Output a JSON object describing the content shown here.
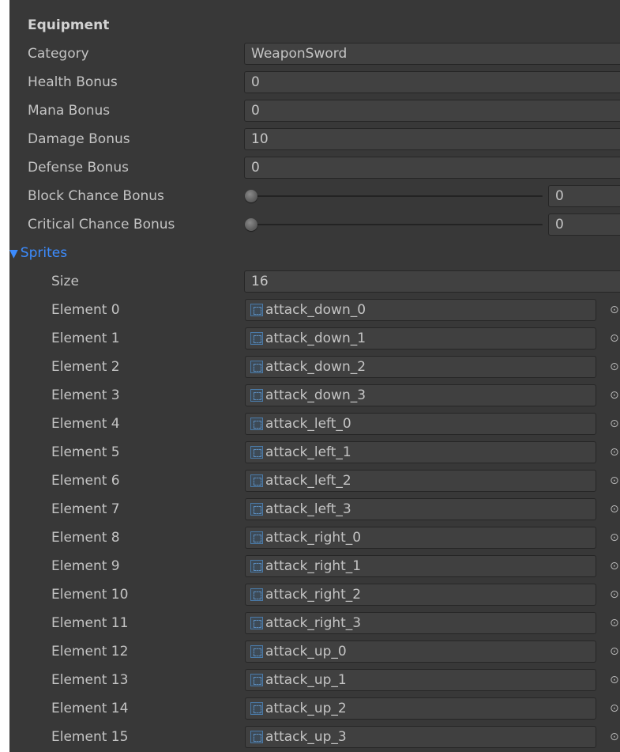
{
  "section_header": "Equipment",
  "fields": {
    "category": {
      "label": "Category",
      "value": "WeaponSword"
    },
    "health_bonus": {
      "label": "Health Bonus",
      "value": "0"
    },
    "mana_bonus": {
      "label": "Mana Bonus",
      "value": "0"
    },
    "damage_bonus": {
      "label": "Damage Bonus",
      "value": "10"
    },
    "defense_bonus": {
      "label": "Defense Bonus",
      "value": "0"
    },
    "block_chance_bonus": {
      "label": "Block Chance Bonus",
      "value": "0",
      "slider_fraction": 0
    },
    "critical_chance_bonus": {
      "label": "Critical Chance Bonus",
      "value": "0",
      "slider_fraction": 0
    }
  },
  "sprites": {
    "label": "Sprites",
    "foldout_icon": "triangle-down-icon",
    "expanded": true,
    "size_label": "Size",
    "size_value": "16",
    "picker_icon": "object-picker-icon",
    "item_icon": "sprite-asset-icon",
    "elements": [
      {
        "label": "Element 0",
        "value": "attack_down_0"
      },
      {
        "label": "Element 1",
        "value": "attack_down_1"
      },
      {
        "label": "Element 2",
        "value": "attack_down_2"
      },
      {
        "label": "Element 3",
        "value": "attack_down_3"
      },
      {
        "label": "Element 4",
        "value": "attack_left_0"
      },
      {
        "label": "Element 5",
        "value": "attack_left_1"
      },
      {
        "label": "Element 6",
        "value": "attack_left_2"
      },
      {
        "label": "Element 7",
        "value": "attack_left_3"
      },
      {
        "label": "Element 8",
        "value": "attack_right_0"
      },
      {
        "label": "Element 9",
        "value": "attack_right_1"
      },
      {
        "label": "Element 10",
        "value": "attack_right_2"
      },
      {
        "label": "Element 11",
        "value": "attack_right_3"
      },
      {
        "label": "Element 12",
        "value": "attack_up_0"
      },
      {
        "label": "Element 13",
        "value": "attack_up_1"
      },
      {
        "label": "Element 14",
        "value": "attack_up_2"
      },
      {
        "label": "Element 15",
        "value": "attack_up_3"
      }
    ]
  },
  "colors": {
    "panel_background": "#383838",
    "field_background": "#414141",
    "foldout_accent": "#3c8cff",
    "label_text": "#c4c4c4"
  }
}
